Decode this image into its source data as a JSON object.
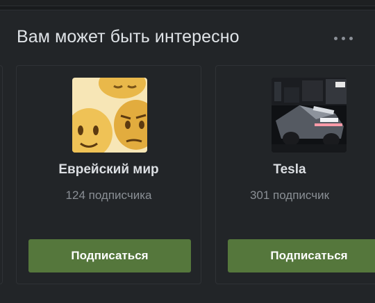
{
  "widget": {
    "title": "Вам может быть интересно",
    "more_icon": "more-horizontal-icon"
  },
  "cards": [
    {
      "name": "Еврейский мир",
      "subscribers": "124 подписчика",
      "button_label": "Подписаться",
      "avatar": "emoji-faces-avatar"
    },
    {
      "name": "Tesla",
      "subscribers": "301 подписчик",
      "button_label": "Подписаться",
      "avatar": "tesla-cybertruck-photo"
    }
  ],
  "colors": {
    "accent_button": "#55773c",
    "panel_bg": "#222528",
    "page_bg": "#191b1d"
  }
}
